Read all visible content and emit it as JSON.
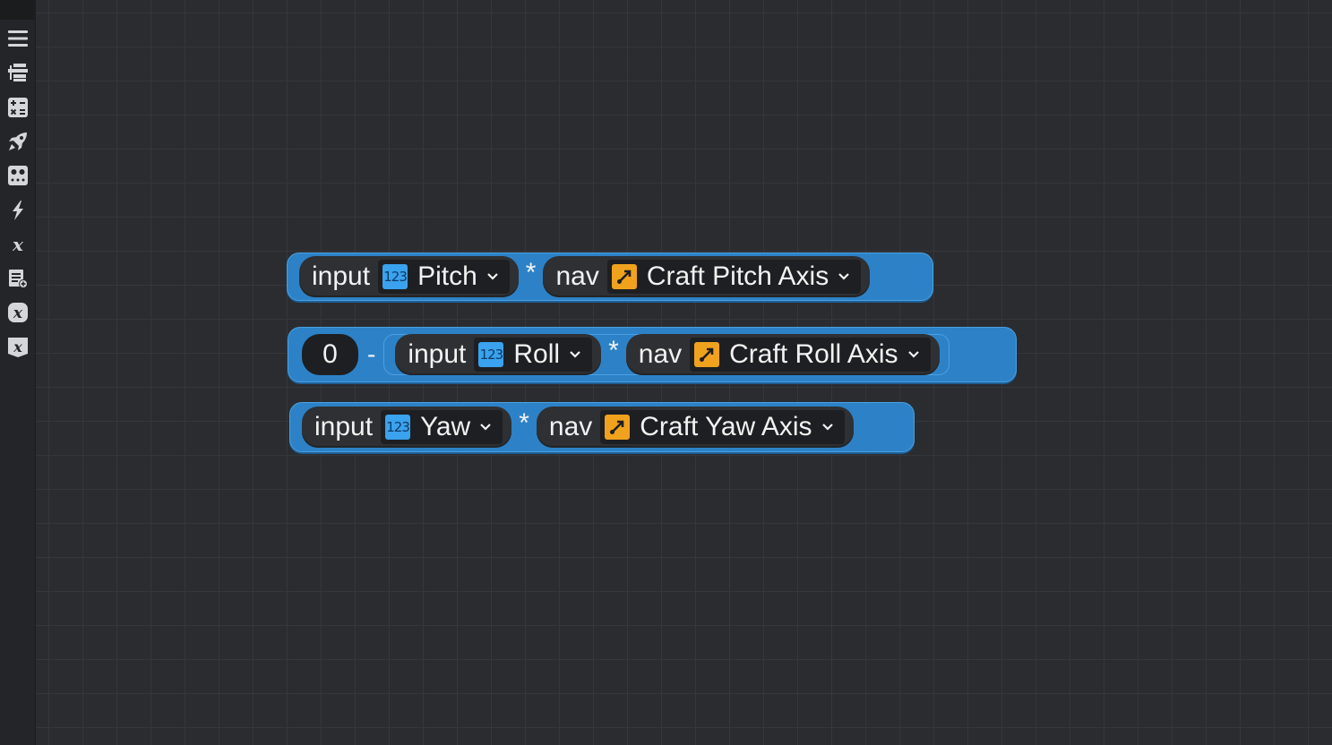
{
  "sidebar": {
    "tools": [
      {
        "name": "menu-icon"
      },
      {
        "name": "blocks-list-icon"
      },
      {
        "name": "math-icon"
      },
      {
        "name": "rocket-icon"
      },
      {
        "name": "controls-icon"
      },
      {
        "name": "lightning-icon"
      },
      {
        "name": "variable-icon"
      },
      {
        "name": "list-add-icon"
      },
      {
        "name": "variable-box-icon"
      },
      {
        "name": "variable-shield-icon"
      }
    ]
  },
  "blocks": {
    "pitch": {
      "input_keyword": "input",
      "input_value": "Pitch",
      "operator": "*",
      "nav_keyword": "nav",
      "nav_value": "Craft Pitch Axis"
    },
    "roll": {
      "number": "0",
      "minus": "-",
      "input_keyword": "input",
      "input_value": "Roll",
      "operator": "*",
      "nav_keyword": "nav",
      "nav_value": "Craft Roll Axis"
    },
    "yaw": {
      "input_keyword": "input",
      "input_value": "Yaw",
      "operator": "*",
      "nav_keyword": "nav",
      "nav_value": "Craft Yaw Axis"
    }
  },
  "badges": {
    "number_badge_text": "123"
  },
  "colors": {
    "block_blue": "#2d82c7",
    "number_badge": "#3aa2ee",
    "nav_badge": "#f0a21e",
    "workspace_bg": "#2a2c30"
  }
}
